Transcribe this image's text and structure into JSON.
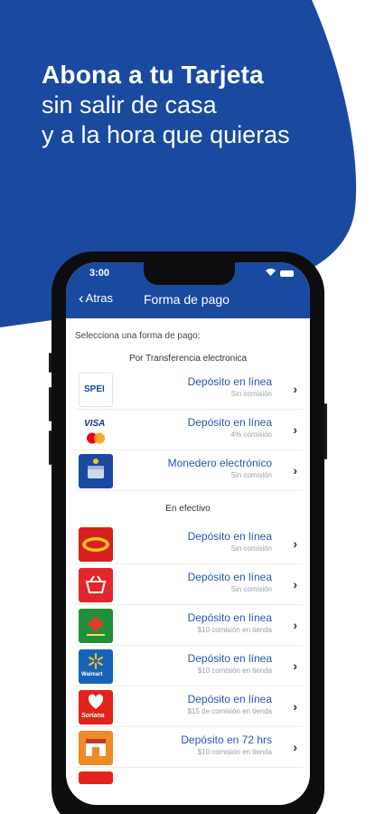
{
  "headline": {
    "line1": "Abona a tu Tarjeta",
    "line2": "sin salir de casa",
    "line3": "y a la hora que quieras"
  },
  "colors": {
    "brand_blue": "#1a4aa0",
    "link_blue": "#2a54b0"
  },
  "phone": {
    "status": {
      "time": "3:00"
    },
    "nav": {
      "back_label": "Atras",
      "title": "Forma de pago"
    },
    "prompt": "Selecciona una forma de pago:",
    "section_transfer": "Por Transferencia electronica",
    "section_cash": "En efectivo",
    "transfer_rows": [
      {
        "logo": "spei-logo",
        "label": "Depósito en línea",
        "sub": "Sin comisión"
      },
      {
        "logo": "visa-mastercard-logo",
        "label": "Depósito en línea",
        "sub": "4% comisión"
      },
      {
        "logo": "wallet-logo",
        "label": "Monedero electrónico",
        "sub": "Sin comisión"
      }
    ],
    "cash_rows": [
      {
        "logo": "oxxo-logo",
        "label": "Depósito en línea",
        "sub": "Sin comisión"
      },
      {
        "logo": "seven-eleven-logo",
        "label": "Depósito en línea",
        "sub": "Sin comisión"
      },
      {
        "logo": "farmacias-logo",
        "label": "Depósito en línea",
        "sub": "$10 comisión en tienda"
      },
      {
        "logo": "walmart-logo",
        "label": "Depósito en línea",
        "sub": "$10 comisión en tienda"
      },
      {
        "logo": "soriana-logo",
        "label": "Depósito en línea",
        "sub": "$15 de comisión en tienda"
      },
      {
        "logo": "store-logo",
        "label": "Depósito en 72 hrs",
        "sub": "$10 comisión en tienda"
      }
    ],
    "logo_text": {
      "spei": "SPEI",
      "visa": "VISA",
      "walmart": "Walmart",
      "soriana": "Soriana"
    }
  }
}
